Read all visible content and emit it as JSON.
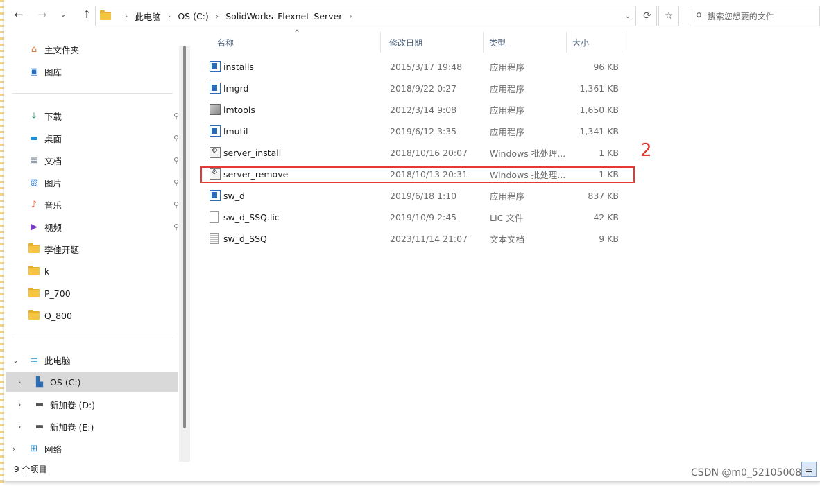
{
  "toolbar": {
    "back_icon": "back-arrow-icon",
    "forward_icon": "forward-arrow-icon",
    "recent_icon": "chevron-down-icon",
    "up_icon": "up-arrow-icon",
    "breadcrumbs": [
      "此电脑",
      "OS (C:)",
      "SolidWorks_Flexnet_Server"
    ],
    "search_placeholder": "搜索您想要的文件"
  },
  "nav": {
    "quick": [
      {
        "label": "主文件夹",
        "icon": "home-icon"
      },
      {
        "label": "图库",
        "icon": "gallery-icon"
      }
    ],
    "pinned": [
      {
        "label": "下载",
        "icon": "download-icon"
      },
      {
        "label": "桌面",
        "icon": "desktop-icon"
      },
      {
        "label": "文档",
        "icon": "document-icon"
      },
      {
        "label": "图片",
        "icon": "pictures-icon"
      },
      {
        "label": "音乐",
        "icon": "music-icon"
      },
      {
        "label": "视频",
        "icon": "video-icon"
      }
    ],
    "folders": [
      "李佳开题",
      "k",
      "P_700",
      "Q_800"
    ],
    "this_pc": "此电脑",
    "drives": [
      "OS (C:)",
      "新加卷 (D:)",
      "新加卷 (E:)"
    ],
    "network": "网络"
  },
  "columns": {
    "name": "名称",
    "date": "修改日期",
    "type": "类型",
    "size": "大小"
  },
  "files": [
    {
      "name": "installs",
      "date": "2015/3/17 19:48",
      "type": "应用程序",
      "size": "96 KB",
      "icon": "app"
    },
    {
      "name": "lmgrd",
      "date": "2018/9/22 0:27",
      "type": "应用程序",
      "size": "1,361 KB",
      "icon": "app"
    },
    {
      "name": "lmtools",
      "date": "2012/3/14 9:08",
      "type": "应用程序",
      "size": "1,650 KB",
      "icon": "tool"
    },
    {
      "name": "lmutil",
      "date": "2019/6/12 3:35",
      "type": "应用程序",
      "size": "1,341 KB",
      "icon": "app"
    },
    {
      "name": "server_install",
      "date": "2018/10/16 20:07",
      "type": "Windows 批处理...",
      "size": "1 KB",
      "icon": "bat"
    },
    {
      "name": "server_remove",
      "date": "2018/10/13 20:31",
      "type": "Windows 批处理...",
      "size": "1 KB",
      "icon": "bat"
    },
    {
      "name": "sw_d",
      "date": "2019/6/18 1:10",
      "type": "应用程序",
      "size": "837 KB",
      "icon": "app"
    },
    {
      "name": "sw_d_SSQ.lic",
      "date": "2019/10/9 2:45",
      "type": "LIC 文件",
      "size": "42 KB",
      "icon": "doc"
    },
    {
      "name": "sw_d_SSQ",
      "date": "2023/11/14 21:07",
      "type": "文本文档",
      "size": "9 KB",
      "icon": "txt"
    }
  ],
  "annotation": "2",
  "status": "9 个项目",
  "watermark": "CSDN @m0_52105008",
  "colors": {
    "highlight": "#e53935",
    "selected_bg": "#d9d9d9"
  }
}
